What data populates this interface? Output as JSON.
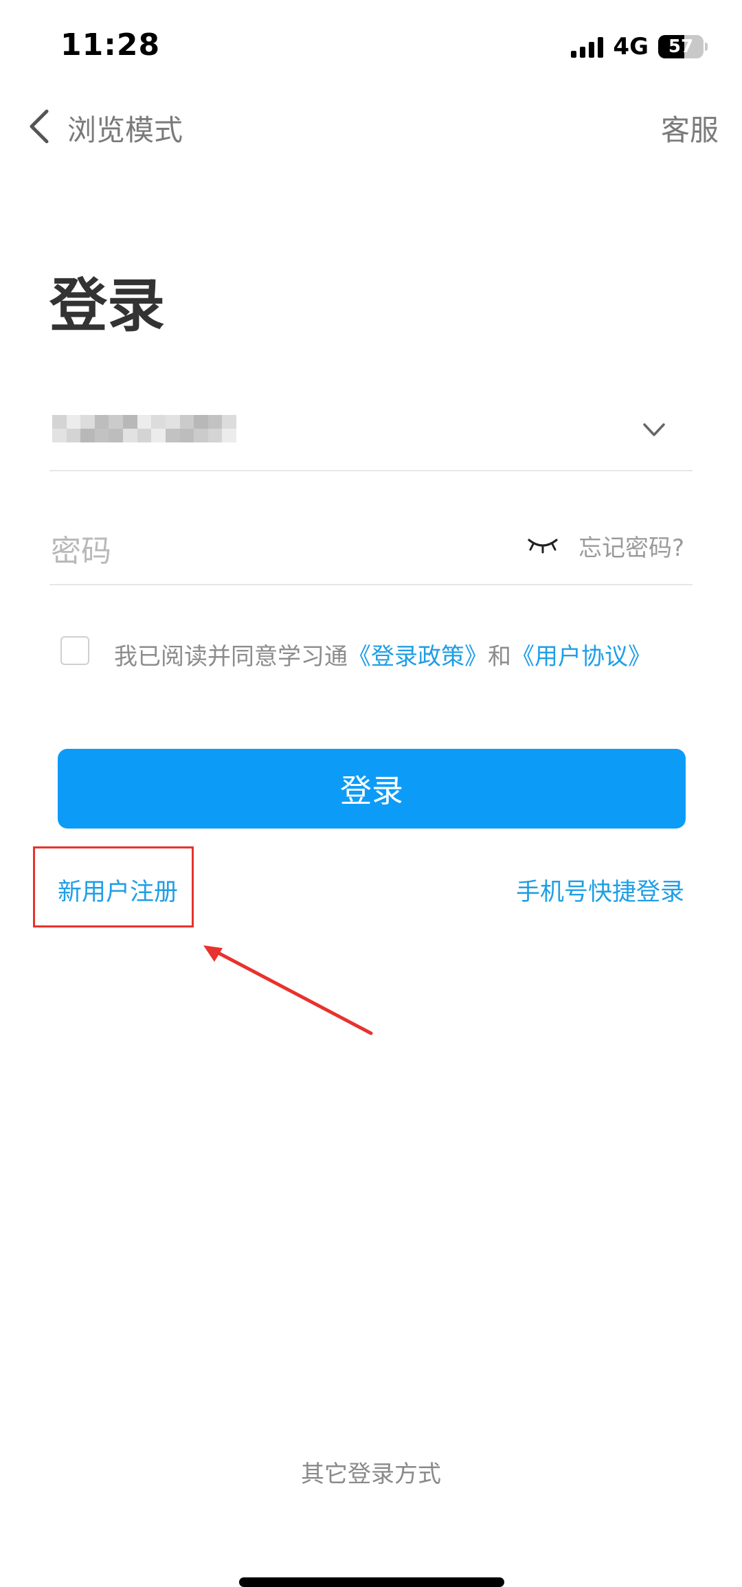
{
  "status_bar": {
    "time": "11:28",
    "network": "4G",
    "battery_percent": "57",
    "battery_level": 0.57,
    "signal_bars": 4
  },
  "nav": {
    "back_icon": "chevron-left-icon",
    "browse_mode": "浏览模式",
    "customer_service": "客服"
  },
  "title": "登录",
  "account": {
    "masked": true,
    "dropdown_icon": "chevron-down-icon"
  },
  "password": {
    "placeholder": "密码",
    "toggle_icon": "eye-closed-icon",
    "forgot": "忘记密码?"
  },
  "agreement": {
    "prefix": "我已阅读并同意学习通",
    "policy": "《登录政策》",
    "and": "和",
    "user_agreement": "《用户协议》",
    "checked": false
  },
  "login_button": "登录",
  "register": "新用户注册",
  "quick_login": "手机号快捷登录",
  "other_methods": "其它登录方式",
  "colors": {
    "accent": "#0c9cf8",
    "link": "#1f9ee6",
    "highlight": "#e8322d"
  }
}
